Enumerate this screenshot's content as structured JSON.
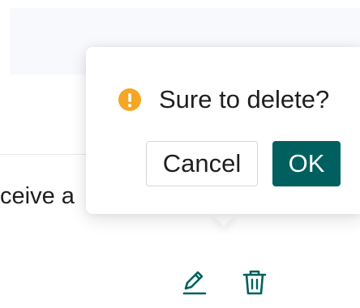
{
  "table": {
    "row_text": "ceive a"
  },
  "confirm_popover": {
    "message": "Sure to delete?",
    "icon": "exclamation-circle-icon",
    "cancel_label": "Cancel",
    "ok_label": "OK"
  },
  "row_actions": [
    {
      "icon": "edit-icon"
    },
    {
      "icon": "delete-icon"
    }
  ],
  "colors": {
    "primary": "#005f5f",
    "warning": "#f5a623",
    "action_icon": "#005f5f",
    "text": "#1f1f1f"
  }
}
